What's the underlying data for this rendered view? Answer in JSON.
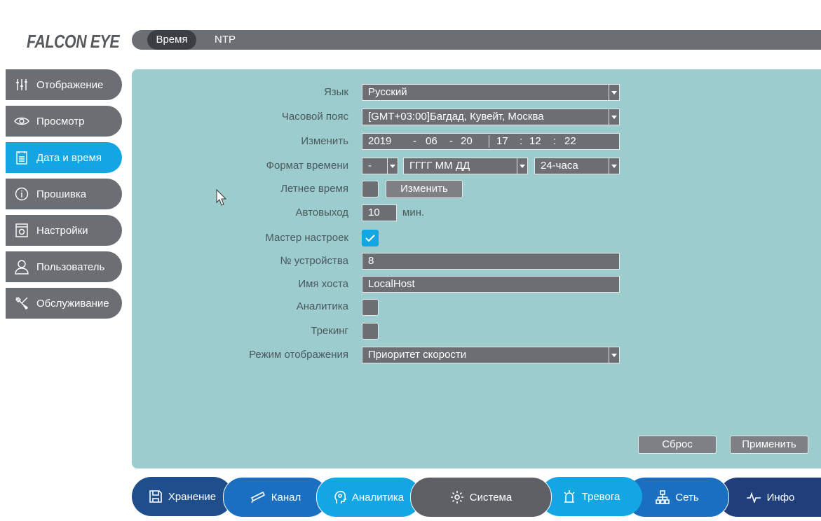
{
  "brand": {
    "logo_text": "FALCON EYE"
  },
  "top_tabs": [
    {
      "label": "Время",
      "active": true
    },
    {
      "label": "NTP",
      "active": false
    }
  ],
  "sidebar": {
    "items": [
      {
        "label": "Отображение",
        "icon": "sliders-icon"
      },
      {
        "label": "Просмотр",
        "icon": "eye-icon"
      },
      {
        "label": "Дата и время",
        "icon": "calendar-icon",
        "active": true
      },
      {
        "label": "Прошивка",
        "icon": "info-icon"
      },
      {
        "label": "Настройки",
        "icon": "settings-file-icon"
      },
      {
        "label": "Пользователь",
        "icon": "user-icon"
      },
      {
        "label": "Обслуживание",
        "icon": "tools-icon"
      }
    ]
  },
  "form": {
    "language": {
      "label": "Язык",
      "value": "Русский"
    },
    "timezone": {
      "label": "Часовой пояс",
      "value": "[GMT+03:00]Багдад, Кувейт, Москва"
    },
    "change": {
      "label": "Изменить",
      "year": "2019",
      "month": "06",
      "day": "20",
      "hour": "17",
      "minute": "12",
      "second": "22",
      "date_sep": "-",
      "time_sep": ":"
    },
    "time_format": {
      "label": "Формат времени",
      "separator": "-",
      "date_format": "ГГГГ ММ ДД",
      "hour_format": "24-часа"
    },
    "dst": {
      "label": "Летнее время",
      "checked": false,
      "button": "Изменить"
    },
    "auto_logout": {
      "label": "Автовыход",
      "value": "10",
      "unit": "мин."
    },
    "wizard": {
      "label": "Мастер настроек",
      "checked": true
    },
    "device_no": {
      "label": "№ устройства",
      "value": "8"
    },
    "hostname": {
      "label": "Имя хоста",
      "value": "LocalHost"
    },
    "analytics": {
      "label": "Аналитика",
      "checked": false
    },
    "tracking": {
      "label": "Трекинг",
      "checked": false
    },
    "display_mode": {
      "label": "Режим отображения",
      "value": "Приоритет скорости"
    }
  },
  "actions": {
    "reset": "Сброс",
    "apply": "Применить"
  },
  "bottom_nav": [
    {
      "label": "Хранение",
      "icon": "save-icon",
      "color": "#1f4e8c"
    },
    {
      "label": "Канал",
      "icon": "camera-icon",
      "color": "#1a6fc0"
    },
    {
      "label": "Аналитика",
      "icon": "head-icon",
      "color": "#14a6e3"
    },
    {
      "label": "Система",
      "icon": "gear-icon",
      "color": "#5d6165",
      "active": true
    },
    {
      "label": "Тревога",
      "icon": "alarm-icon",
      "color": "#14a6e3"
    },
    {
      "label": "Сеть",
      "icon": "network-icon",
      "color": "#1a6fc0"
    },
    {
      "label": "Инфо",
      "icon": "pulse-icon",
      "color": "#1f3e7a"
    }
  ]
}
